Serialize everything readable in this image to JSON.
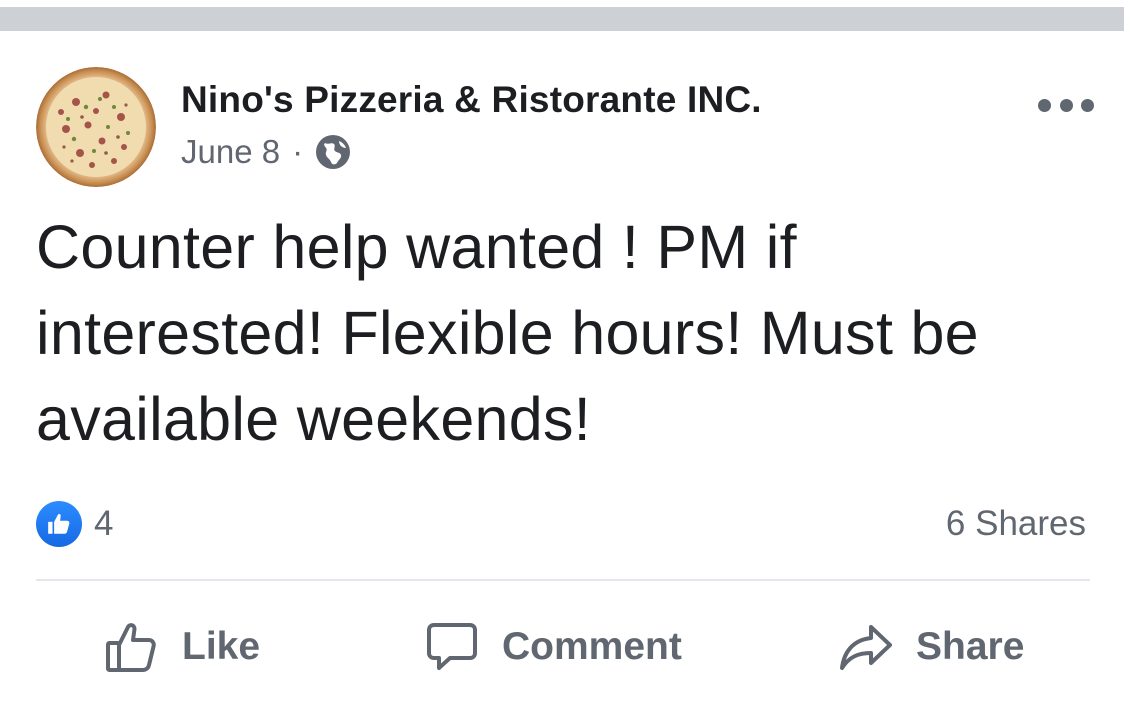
{
  "post": {
    "page_name": "Nino's Pizzeria & Ristorante INC.",
    "date": "June 8",
    "separator": "·",
    "privacy_icon": "globe-icon",
    "menu_icon": "more-options-icon",
    "text": "Counter help wanted ! PM if interested! Flexible hours! Must be available weekends!"
  },
  "stats": {
    "reaction_icon": "like-reaction-icon",
    "reaction_count": "4",
    "shares": "6 Shares"
  },
  "actions": {
    "like_label": "Like",
    "comment_label": "Comment",
    "share_label": "Share"
  },
  "colors": {
    "text_primary": "#1c1e21",
    "text_secondary": "#606770",
    "like_blue": "#1877f2",
    "top_bar": "#cdd0d5",
    "divider": "#e4e6eb"
  }
}
